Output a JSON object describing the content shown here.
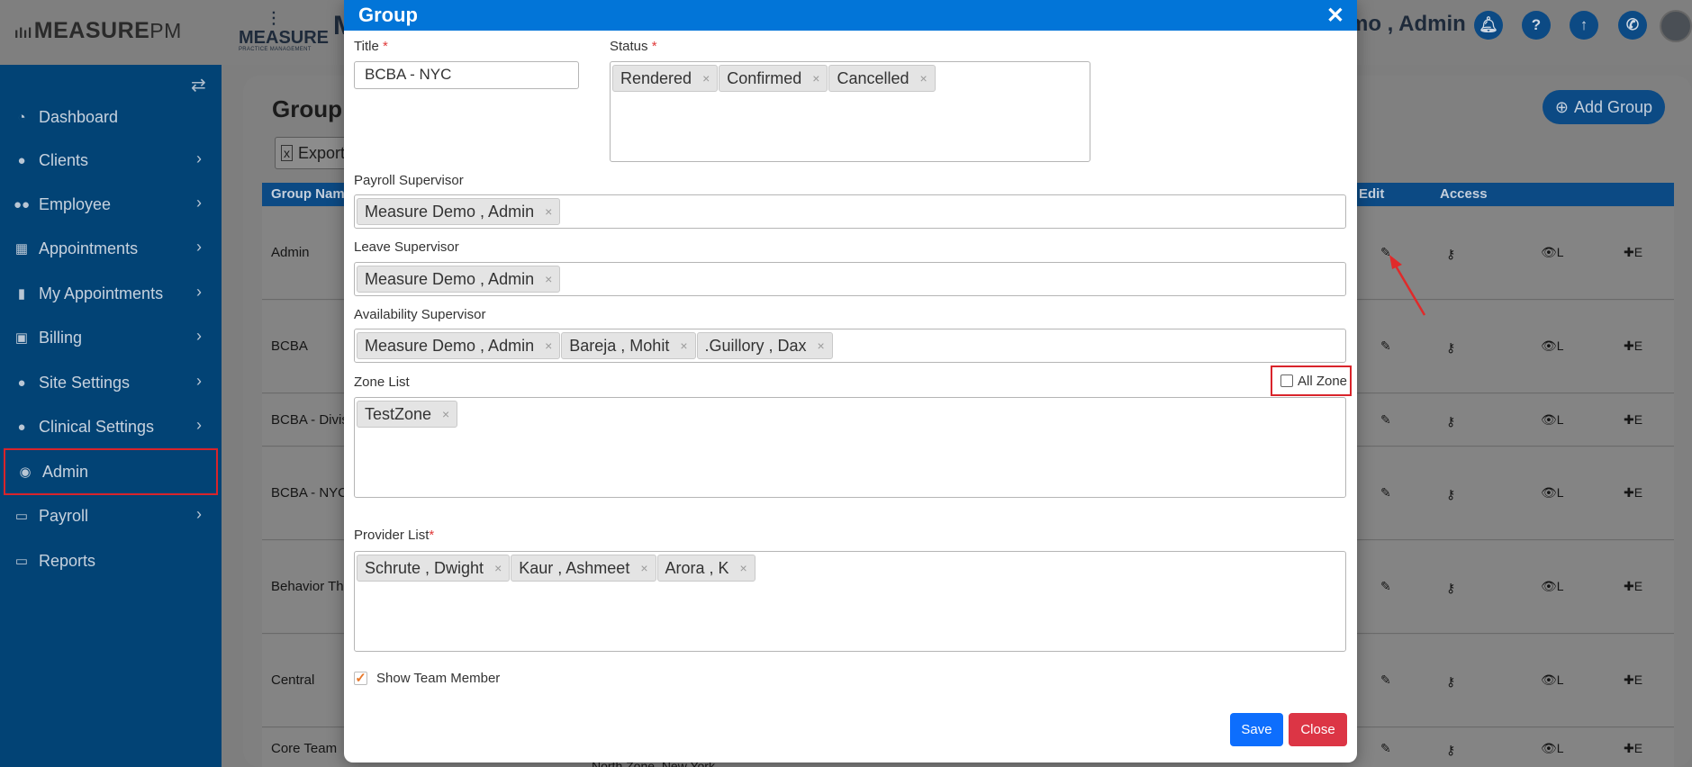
{
  "header": {
    "logo_main": "MEASURE",
    "logo_main_suffix": "PM",
    "logo_secondary": "MEASURE",
    "logo_secondary_sub": "PRACTICE MANAGEMENT",
    "title_partial": "M",
    "user_name": "mo , Admin"
  },
  "sidebar": {
    "items": [
      {
        "label": "Dashboard",
        "icon": "tachometer-icon",
        "has_children": false
      },
      {
        "label": "Clients",
        "icon": "user-icon",
        "has_children": true
      },
      {
        "label": "Employee",
        "icon": "users-icon",
        "has_children": true
      },
      {
        "label": "Appointments",
        "icon": "calendar-icon",
        "has_children": true
      },
      {
        "label": "My Appointments",
        "icon": "book-icon",
        "has_children": true
      },
      {
        "label": "Billing",
        "icon": "money-icon",
        "has_children": true
      },
      {
        "label": "Site Settings",
        "icon": "user-icon",
        "has_children": true
      },
      {
        "label": "Clinical Settings",
        "icon": "user-icon",
        "has_children": true
      },
      {
        "label": "Admin",
        "icon": "user-circle-icon",
        "has_children": false,
        "active": true
      },
      {
        "label": "Payroll",
        "icon": "credit-card-icon",
        "has_children": true
      },
      {
        "label": "Reports",
        "icon": "credit-card-icon",
        "has_children": false
      }
    ]
  },
  "page": {
    "title": "Group",
    "add_button": "Add Group",
    "export_button": "Export"
  },
  "table": {
    "headers": [
      "Group Nam",
      "Edit",
      "Access"
    ],
    "rows": [
      {
        "name": "Admin",
        "view": "L",
        "add": "E"
      },
      {
        "name": "BCBA",
        "view": "L",
        "add": "E"
      },
      {
        "name": "BCBA - Divis",
        "view": "L",
        "add": "E"
      },
      {
        "name": "BCBA - NYC",
        "view": "L",
        "add": "E"
      },
      {
        "name": "Behavior The",
        "view": "L",
        "add": "E"
      },
      {
        "name": "Central",
        "view": "L",
        "add": "E"
      },
      {
        "name": "Core Team",
        "view": "L",
        "add": "E",
        "extra": "North Zone, New York"
      }
    ]
  },
  "modal": {
    "title": "Group",
    "title_label": "Title",
    "title_value": "BCBA - NYC",
    "status_label": "Status",
    "status_tags": [
      "Rendered",
      "Confirmed",
      "Cancelled"
    ],
    "payroll_label": "Payroll Supervisor",
    "payroll_tags": [
      "Measure Demo , Admin"
    ],
    "leave_label": "Leave Supervisor",
    "leave_tags": [
      "Measure Demo , Admin"
    ],
    "availability_label": "Availability Supervisor",
    "availability_tags": [
      "Measure Demo , Admin",
      "Bareja , Mohit",
      ".Guillory , Dax"
    ],
    "zone_label": "Zone List",
    "zone_tags": [
      "TestZone"
    ],
    "all_zone_label": "All Zone",
    "all_zone_checked": false,
    "provider_label": "Provider List",
    "provider_tags": [
      "Schrute , Dwight",
      "Kaur , Ashmeet",
      "Arora , K"
    ],
    "show_team_label": "Show Team Member",
    "show_team_checked": true,
    "save_label": "Save",
    "close_label": "Close",
    "required_mark": "*",
    "tag_remove": "×"
  },
  "colors": {
    "modal_header": "#0275d8",
    "sidebar": "#024375",
    "save": "#0d6efd",
    "close": "#dc3545",
    "highlight": "#d9242b"
  }
}
